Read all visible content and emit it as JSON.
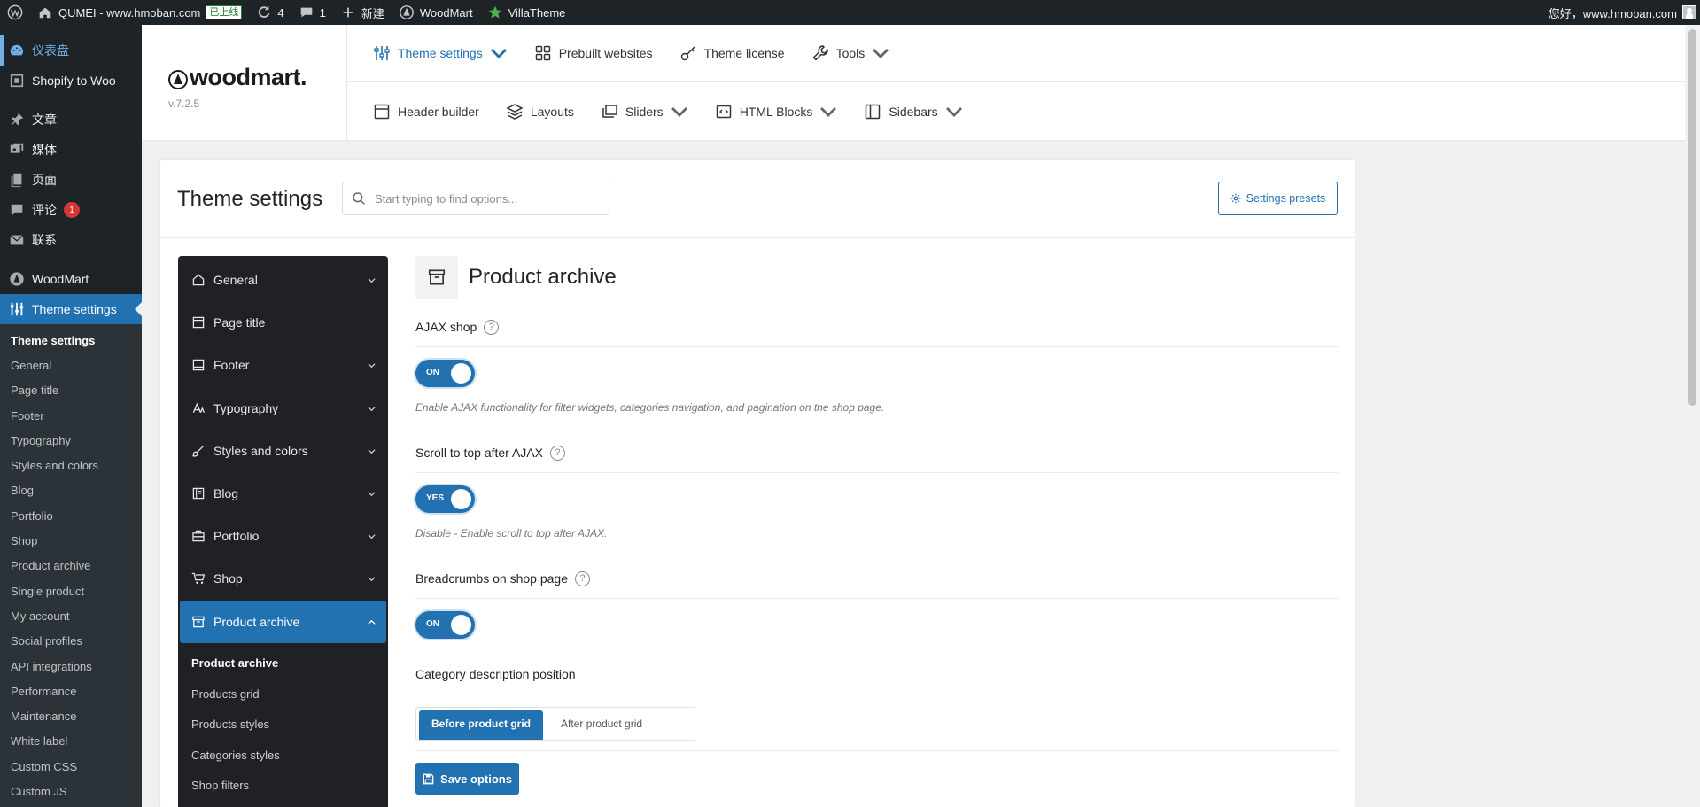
{
  "admin_bar": {
    "site_name": "QUMEI - www.hmoban.com",
    "status_badge": "已上线",
    "updates_count": "4",
    "comments_count": "1",
    "new_label": "新建",
    "woodmart_label": "WoodMart",
    "villatheme_label": "VillaTheme",
    "greeting": "您好，www.hmoban.com"
  },
  "wp_menu": {
    "items": [
      {
        "label": "仪表盘",
        "icon": "dashboard-icon"
      },
      {
        "label": "Shopify to Woo",
        "icon": "import-icon"
      },
      {
        "label": "文章",
        "icon": "pin-icon"
      },
      {
        "label": "媒体",
        "icon": "media-icon"
      },
      {
        "label": "页面",
        "icon": "page-icon"
      },
      {
        "label": "评论",
        "icon": "comment-icon",
        "badge": "1"
      },
      {
        "label": "联系",
        "icon": "mail-icon"
      },
      {
        "label": "WoodMart",
        "icon": "woodmart-icon"
      },
      {
        "label": "Theme settings",
        "icon": "sliders-icon"
      }
    ],
    "submenu": [
      "Theme settings",
      "General",
      "Page title",
      "Footer",
      "Typography",
      "Styles and colors",
      "Blog",
      "Portfolio",
      "Shop",
      "Product archive",
      "Single product",
      "My account",
      "Social profiles",
      "API integrations",
      "Performance",
      "Maintenance",
      "White label",
      "Custom CSS",
      "Custom JS"
    ]
  },
  "woodmart_header": {
    "logo": "woodmart.",
    "version": "v.7.2.5",
    "nav_top": [
      {
        "label": "Theme settings",
        "icon": "sliders-icon"
      },
      {
        "label": "Prebuilt websites",
        "icon": "grid-icon"
      },
      {
        "label": "Theme license",
        "icon": "key-icon"
      },
      {
        "label": "Tools",
        "icon": "wrench-icon"
      }
    ],
    "nav_bottom": [
      {
        "label": "Header builder",
        "icon": "header-icon"
      },
      {
        "label": "Layouts",
        "icon": "layers-icon"
      },
      {
        "label": "Sliders",
        "icon": "slides-icon"
      },
      {
        "label": "HTML Blocks",
        "icon": "code-block-icon"
      },
      {
        "label": "Sidebars",
        "icon": "sidebar-icon"
      }
    ]
  },
  "panel": {
    "title": "Theme settings",
    "search_placeholder": "Start typing to find options...",
    "presets_label": "Settings presets"
  },
  "section_nav": {
    "items": [
      {
        "label": "General",
        "icon": "home-icon"
      },
      {
        "label": "Page title",
        "icon": "page-title-icon"
      },
      {
        "label": "Footer",
        "icon": "footer-icon"
      },
      {
        "label": "Typography",
        "icon": "typography-icon"
      },
      {
        "label": "Styles and colors",
        "icon": "brush-icon"
      },
      {
        "label": "Blog",
        "icon": "blog-icon"
      },
      {
        "label": "Portfolio",
        "icon": "briefcase-icon"
      },
      {
        "label": "Shop",
        "icon": "cart-icon"
      },
      {
        "label": "Product archive",
        "icon": "archive-icon"
      }
    ],
    "sub_items": [
      "Product archive",
      "Products grid",
      "Products styles",
      "Categories styles",
      "Shop filters"
    ]
  },
  "content": {
    "title": "Product archive",
    "options": [
      {
        "label": "AJAX shop",
        "help": "?",
        "toggle": "ON",
        "description": "Enable AJAX functionality for filter widgets, categories navigation, and pagination on the shop page."
      },
      {
        "label": "Scroll to top after AJAX",
        "help": "?",
        "toggle": "YES",
        "description": "Disable - Enable scroll to top after AJAX."
      },
      {
        "label": "Breadcrumbs on shop page",
        "help": "?",
        "toggle": "ON"
      },
      {
        "label": "Category description position",
        "choices": [
          "Before product grid",
          "After product grid"
        ],
        "selected": "Before product grid"
      }
    ],
    "save_label": "Save options"
  },
  "colors": {
    "accent": "#2271b1",
    "admin_dark": "#1d2327",
    "section_nav_bg": "#1f2124"
  }
}
